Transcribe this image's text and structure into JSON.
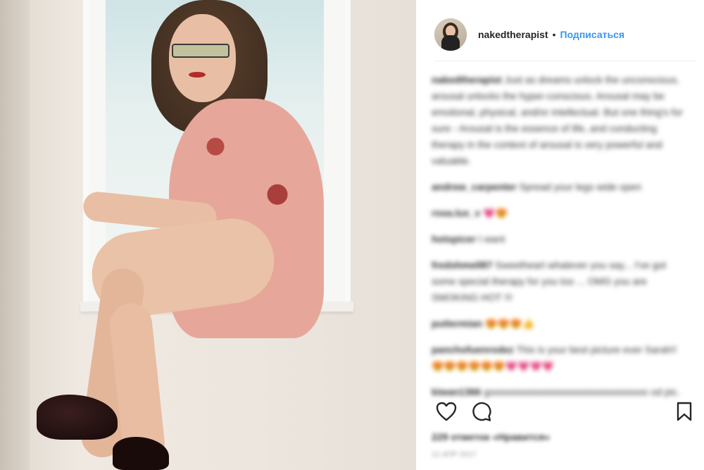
{
  "post": {
    "username": "nakedtherapist",
    "separator": "•",
    "follow_label": "Подписаться"
  },
  "caption": {
    "author": "nakedtherapist",
    "text": "Just as dreams unlock the unconscious, arousal unlocks the hyper-conscious. Arousal may be emotional, physical, and/or intellectual. But one thing's for sure - Arousal is the essence of life, and conducting therapy in the context of arousal is very powerful and valuable."
  },
  "comments": [
    {
      "user": "andrew_carpenter",
      "text": "Spread your legs wide open"
    },
    {
      "user": "rosa.lux_v",
      "text": "💗😍"
    },
    {
      "user": "hotspicer",
      "text": "I want"
    },
    {
      "user": "fredshmell87",
      "text": "Sweetheart whatever you say... I've got some special therapy for you too ... OMG you are SMOKING HOT !!!"
    },
    {
      "user": "puttermian",
      "text": "😍😍😍👍"
    },
    {
      "user": "panchofuenrodez",
      "text": "This is your best picture ever Sarah!! 😍😍😍😍😍😍💗💗💗💗"
    },
    {
      "user": "kiwan1366",
      "text": "gooooooooooooooooooooooooooooo od pic. I love you"
    }
  ],
  "likes_text": "229 отметок «Нравится»",
  "date_text": "12 АПР 2017",
  "icons": {
    "like": "heart-icon",
    "comment": "comment-icon",
    "save": "bookmark-icon"
  }
}
